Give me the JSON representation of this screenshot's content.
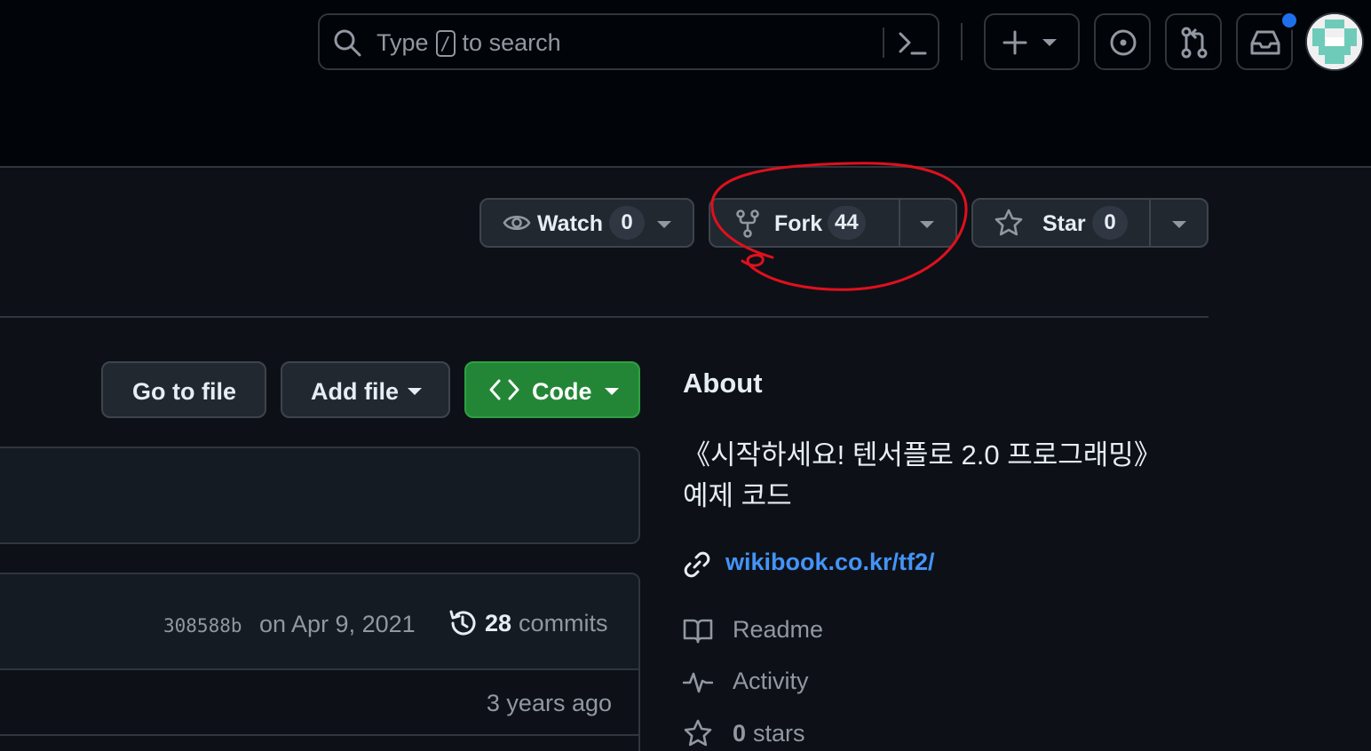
{
  "header": {
    "search": {
      "placeholder_prefix": "Type",
      "shortcut_key": "/",
      "placeholder_suffix": "to search",
      "icon": "search-icon",
      "command_icon": "command-palette-icon"
    },
    "buttons": [
      {
        "name": "create-new-button",
        "icon": "plus-icon"
      },
      {
        "name": "issues-button",
        "icon": "issue-opened-icon"
      },
      {
        "name": "pull-requests-button",
        "icon": "git-pull-request-icon"
      },
      {
        "name": "inbox-button",
        "icon": "inbox-icon"
      }
    ],
    "avatar": "user-avatar"
  },
  "repo_actions": {
    "watch": {
      "label": "Watch",
      "count": "0",
      "icon": "eye-icon"
    },
    "fork": {
      "label": "Fork",
      "count": "44",
      "icon": "repo-forked-icon"
    },
    "star": {
      "label": "Star",
      "count": "0",
      "icon": "star-icon"
    }
  },
  "file_toolbar": {
    "go_to_file": "Go to file",
    "add_file": "Add file",
    "code": "Code"
  },
  "latest_commit": {
    "sha": "308588b",
    "date": "on Apr 9, 2021",
    "commit_count": "28",
    "commit_label": "commits"
  },
  "file_rows": [
    {
      "time": "3 years ago"
    }
  ],
  "about": {
    "title": "About",
    "description_line1": "《시작하세요! 텐서플로 2.0 프로그래밍》",
    "description_line2": "예제 코드",
    "link": "wikibook.co.kr/tf2/",
    "items": [
      {
        "icon": "book-icon",
        "label": "Readme"
      },
      {
        "icon": "pulse-icon",
        "label": "Activity"
      },
      {
        "icon": "star-icon",
        "count": "0",
        "label": "stars"
      }
    ]
  },
  "colors": {
    "background": "#0d1117",
    "header_background": "#010409",
    "border": "#30363d",
    "accent_link": "#4493f8",
    "code_button": "#238636",
    "annotation": "#e0101e",
    "notification_dot": "#1f6feb"
  }
}
